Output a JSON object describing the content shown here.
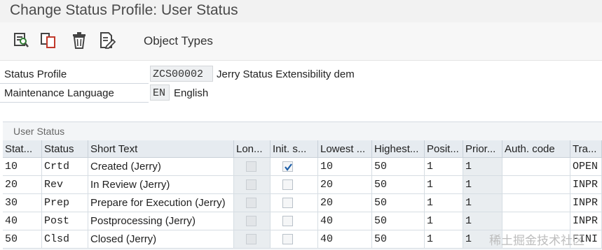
{
  "window": {
    "title": "Change Status Profile: User Status"
  },
  "toolbar": {
    "icons": [
      "display-change-icon",
      "copy-icon",
      "delete-icon",
      "edit-details-icon"
    ],
    "object_types_label": "Object Types"
  },
  "form": {
    "status_profile": {
      "label": "Status Profile",
      "value": "ZCS00002",
      "description": "Jerry Status Extensibility dem"
    },
    "language": {
      "label": "Maintenance Language",
      "value": "EN",
      "description": "English"
    }
  },
  "user_status": {
    "group_title": "User Status",
    "columns": [
      "Stat...",
      "Status",
      "Short Text",
      "Lon...",
      "Init. s...",
      "Lowest ...",
      "Highest...",
      "Posit...",
      "Prior...",
      "Auth. code",
      "Tra..."
    ],
    "rows": [
      {
        "stat": "10",
        "status": "Crtd",
        "short_text": "Created (Jerry)",
        "long": false,
        "init": true,
        "lowest": "10",
        "highest": "50",
        "position": "1",
        "priority": "1",
        "auth": "",
        "trans": "OPEN"
      },
      {
        "stat": "20",
        "status": "Rev",
        "short_text": "In Review (Jerry)",
        "long": false,
        "init": false,
        "lowest": "20",
        "highest": "50",
        "position": "1",
        "priority": "1",
        "auth": "",
        "trans": "INPR"
      },
      {
        "stat": "30",
        "status": "Prep",
        "short_text": "Prepare for Execution (Jerry)",
        "long": false,
        "init": false,
        "lowest": "20",
        "highest": "50",
        "position": "1",
        "priority": "1",
        "auth": "",
        "trans": "INPR"
      },
      {
        "stat": "40",
        "status": "Post",
        "short_text": "Postprocessing (Jerry)",
        "long": false,
        "init": false,
        "lowest": "40",
        "highest": "50",
        "position": "1",
        "priority": "1",
        "auth": "",
        "trans": "INPR"
      },
      {
        "stat": "50",
        "status": "Clsd",
        "short_text": "Closed (Jerry)",
        "long": false,
        "init": false,
        "lowest": "40",
        "highest": "50",
        "position": "1",
        "priority": "1",
        "auth": "",
        "trans": "FINI"
      }
    ]
  },
  "watermark": "稀土掘金技术社区"
}
